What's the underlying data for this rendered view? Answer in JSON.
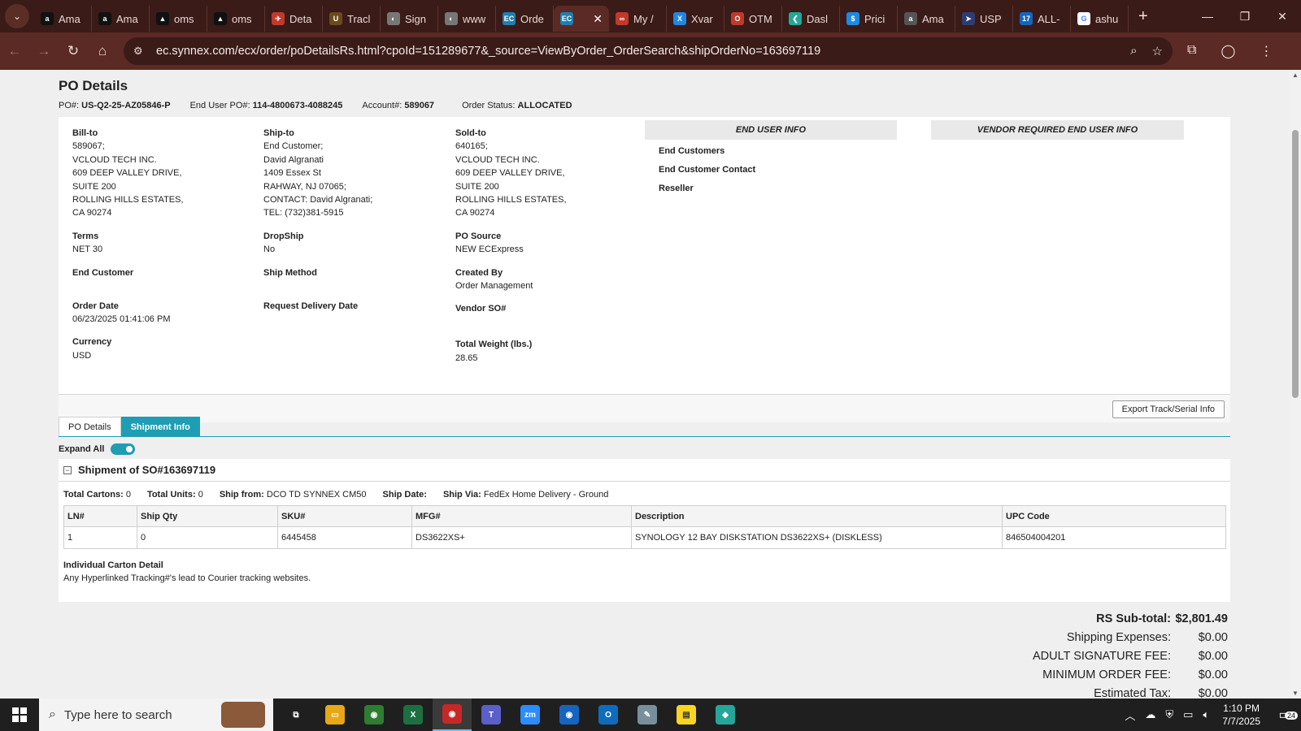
{
  "browser": {
    "tabs": [
      {
        "title": "Ama",
        "icon": "amazon-icon",
        "color": "#111111",
        "glyph": "a"
      },
      {
        "title": "Ama",
        "icon": "amazon-icon",
        "color": "#111111",
        "glyph": "a"
      },
      {
        "title": "oms",
        "icon": "oms-icon",
        "color": "#111111",
        "glyph": "▲"
      },
      {
        "title": "oms",
        "icon": "oms-icon",
        "color": "#111111",
        "glyph": "▲"
      },
      {
        "title": "Deta",
        "icon": "details-icon",
        "color": "#c0392b",
        "glyph": "✈"
      },
      {
        "title": "Tracl",
        "icon": "ups-icon",
        "color": "#6b4a1c",
        "glyph": "U"
      },
      {
        "title": "Sign",
        "icon": "globe-icon",
        "color": "#777777",
        "glyph": "◐"
      },
      {
        "title": "www",
        "icon": "globe-icon",
        "color": "#777777",
        "glyph": "◐"
      },
      {
        "title": "Orde",
        "icon": "ec-icon",
        "color": "#1e7fb0",
        "glyph": "EC"
      },
      {
        "title": "",
        "icon": "ec-icon",
        "color": "#1e7fb0",
        "glyph": "EC",
        "active": true
      },
      {
        "title": "My /",
        "icon": "myapp-icon",
        "color": "#c0392b",
        "glyph": "∞"
      },
      {
        "title": "Xvar",
        "icon": "xvar-icon",
        "color": "#1e88e5",
        "glyph": "X"
      },
      {
        "title": "OTM",
        "icon": "otm-icon",
        "color": "#c0392b",
        "glyph": "O"
      },
      {
        "title": "Dasl",
        "icon": "dashboard-icon",
        "color": "#26a69a",
        "glyph": "❮"
      },
      {
        "title": "Prici",
        "icon": "pricing-icon",
        "color": "#1e88e5",
        "glyph": "$"
      },
      {
        "title": "Ama",
        "icon": "amazon-icon",
        "color": "#555555",
        "glyph": "a"
      },
      {
        "title": "USP",
        "icon": "usps-icon",
        "color": "#2c3e70",
        "glyph": "➤"
      },
      {
        "title": "ALL-",
        "icon": "17track-icon",
        "color": "#1565c0",
        "glyph": "17"
      },
      {
        "title": "ashu",
        "icon": "google-icon",
        "color": "#ffffff",
        "glyph": "G"
      }
    ],
    "url": "ec.synnex.com/ecx/order/poDetailsRs.html?cpoId=151289677&_source=ViewByOrder_OrderSearch&shipOrderNo=163697119"
  },
  "po": {
    "title": "PO Details",
    "po_label": "PO#:",
    "po_value": "US-Q2-25-AZ05846-P",
    "enduser_po_label": "End User PO#:",
    "enduser_po_value": "114-4800673-4088245",
    "account_label": "Account#:",
    "account_value": "589067",
    "status_label": "Order Status:",
    "status_value": "ALLOCATED"
  },
  "bill_to": {
    "label": "Bill-to",
    "lines": [
      "589067;",
      "VCLOUD TECH INC.",
      "609 DEEP VALLEY DRIVE,",
      "SUITE 200",
      "ROLLING HILLS ESTATES,",
      "CA 90274"
    ]
  },
  "ship_to": {
    "label": "Ship-to",
    "lines": [
      "End Customer;",
      "David Algranati",
      "1409 Essex St",
      "RAHWAY, NJ 07065;",
      "CONTACT: David Algranati;",
      "TEL: (732)381-5915"
    ]
  },
  "sold_to": {
    "label": "Sold-to",
    "lines": [
      "640165;",
      "VCLOUD TECH INC.",
      "609 DEEP VALLEY DRIVE,",
      "SUITE 200",
      "ROLLING HILLS ESTATES,",
      "CA 90274"
    ]
  },
  "fields": {
    "terms": {
      "label": "Terms",
      "value": "NET 30"
    },
    "dropship": {
      "label": "DropShip",
      "value": "No"
    },
    "po_source": {
      "label": "PO Source",
      "value": "NEW ECExpress"
    },
    "end_customer": {
      "label": "End Customer",
      "value": ""
    },
    "ship_method": {
      "label": "Ship Method",
      "value": ""
    },
    "created_by": {
      "label": "Created By",
      "value": "Order Management"
    },
    "order_date": {
      "label": "Order Date",
      "value": "06/23/2025 01:41:06 PM"
    },
    "request_delivery": {
      "label": "Request Delivery Date",
      "value": ""
    },
    "vendor_so": {
      "label": "Vendor SO#",
      "value": ""
    },
    "currency": {
      "label": "Currency",
      "value": "USD"
    },
    "total_weight": {
      "label": "Total Weight (lbs.)",
      "value": "28.65"
    }
  },
  "end_user_info": {
    "header": "END USER INFO",
    "items": [
      "End Customers",
      "End Customer Contact",
      "Reseller"
    ]
  },
  "vendor_info": {
    "header": "VENDOR REQUIRED END USER INFO"
  },
  "export_button": "Export Track/Serial Info",
  "page_tabs": [
    {
      "label": "PO Details",
      "active": false
    },
    {
      "label": "Shipment Info",
      "active": true
    }
  ],
  "expand_all": {
    "label": "Expand All",
    "on": true
  },
  "shipment": {
    "title": "Shipment of SO#163697119",
    "total_cartons_label": "Total Cartons:",
    "total_cartons": "0",
    "total_units_label": "Total Units:",
    "total_units": "0",
    "ship_from_label": "Ship from:",
    "ship_from": "DCO TD SYNNEX CM50",
    "ship_date_label": "Ship Date:",
    "ship_date": "",
    "ship_via_label": "Ship Via:",
    "ship_via": "FedEx Home Delivery - Ground",
    "columns": [
      "LN#",
      "Ship Qty",
      "SKU#",
      "MFG#",
      "Description",
      "UPC Code"
    ],
    "rows": [
      [
        "1",
        "0",
        "6445458",
        "DS3622XS+",
        "SYNOLOGY 12 BAY DISKSTATION DS3622XS+ (DISKLESS)",
        "846504004201"
      ]
    ],
    "carton_header": "Individual Carton Detail",
    "carton_note": "Any Hyperlinked Tracking#'s lead to Courier tracking websites."
  },
  "totals": [
    {
      "label": "RS Sub-total:",
      "value": "$2,801.49",
      "bold": true
    },
    {
      "label": "Shipping Expenses:",
      "value": "$0.00"
    },
    {
      "label": "ADULT SIGNATURE FEE:",
      "value": "$0.00"
    },
    {
      "label": "MINIMUM ORDER FEE:",
      "value": "$0.00"
    },
    {
      "label": "Estimated Tax:",
      "value": "$0.00"
    }
  ],
  "taskbar": {
    "search_placeholder": "Type here to search",
    "apps": [
      {
        "name": "task-view-icon",
        "color": "#1f1f1f",
        "glyph": "⧉"
      },
      {
        "name": "file-explorer-icon",
        "color": "#e6a817",
        "glyph": "▭"
      },
      {
        "name": "chrome-icon",
        "color": "#2e7d32",
        "glyph": "◉"
      },
      {
        "name": "excel-icon",
        "color": "#1d6f42",
        "glyph": "X"
      },
      {
        "name": "chrome-profile-icon",
        "color": "#c62828",
        "glyph": "◉",
        "active": true
      },
      {
        "name": "teams-icon",
        "color": "#5b5fc7",
        "glyph": "T"
      },
      {
        "name": "zoom-icon",
        "color": "#2d8cff",
        "glyph": "zm"
      },
      {
        "name": "chrome-icon",
        "color": "#1565c0",
        "glyph": "◉"
      },
      {
        "name": "outlook-icon",
        "color": "#0f6cbd",
        "glyph": "O"
      },
      {
        "name": "notes-icon",
        "color": "#78909c",
        "glyph": "✎"
      },
      {
        "name": "sticky-notes-icon",
        "color": "#f9d423",
        "glyph": "▤"
      },
      {
        "name": "app-icon",
        "color": "#26a69a",
        "glyph": "◆"
      }
    ],
    "time": "1:10 PM",
    "date": "7/7/2025",
    "notifications": "24"
  },
  "colors": {
    "accent": "#1e9db3",
    "chrome_dark": "#3a1b17",
    "chrome_mid": "#5b2a24"
  }
}
